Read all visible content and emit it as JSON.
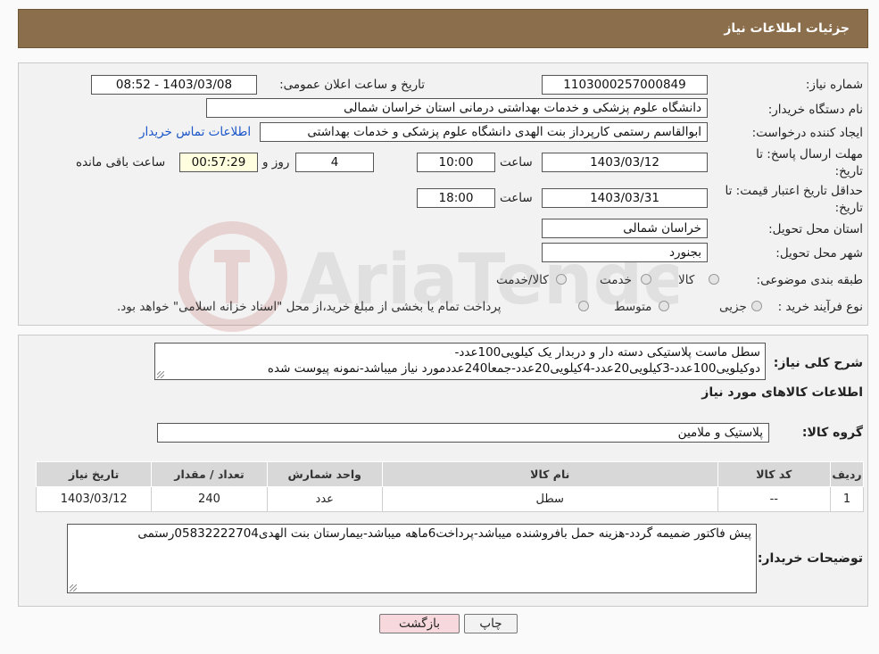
{
  "header": {
    "title": "جزئیات اطلاعات نیاز"
  },
  "form": {
    "need_number_label": "شماره نیاز:",
    "need_number": "1103000257000849",
    "announce_label": "تاریخ و ساعت اعلان عمومی:",
    "announce_value": "1403/03/08 - 08:52",
    "buyer_org_label": "نام دستگاه خریدار:",
    "buyer_org": "دانشگاه علوم پزشکی و خدمات بهداشتی درمانی استان خراسان شمالی",
    "creator_label": "ایجاد کننده درخواست:",
    "creator": "ابوالقاسم رستمی کارپرداز بنت الهدی دانشگاه علوم پزشکی و خدمات بهداشتی",
    "contact_link": "اطلاعات تماس خریدار",
    "deadline_label_1": "مهلت ارسال پاسخ: تا",
    "deadline_label_2": "تاریخ:",
    "deadline_date": "1403/03/12",
    "time_label": "ساعت",
    "deadline_time": "10:00",
    "days_value": "4",
    "days_label": "روز و",
    "remaining_time": "00:57:29",
    "remaining_label": "ساعت باقی مانده",
    "validity_label_1": "حداقل تاریخ اعتبار قیمت: تا",
    "validity_label_2": "تاریخ:",
    "validity_date": "1403/03/31",
    "validity_time": "18:00",
    "province_label": "استان محل تحویل:",
    "province": "خراسان شمالی",
    "city_label": "شهر محل تحویل:",
    "city": "بجنورد",
    "category_label": "طبقه بندی موضوعی:",
    "category_options": [
      "کالا",
      "خدمت",
      "کالا/خدمت"
    ],
    "process_label": "نوع فرآیند خرید :",
    "process_options": [
      "جزیی",
      "متوسط"
    ],
    "payment_note": "پرداخت تمام یا بخشی از مبلغ خرید،از محل \"اسناد خزانه اسلامی\" خواهد بود."
  },
  "details": {
    "summary_label": "شرح کلی نیاز:",
    "summary_line1": "سطل ماست پلاستیکی دسته دار و دربدار یک کیلویی100عدد-",
    "summary_line2": "دوکیلویی100عدد-3کیلویی20عدد-4کیلویی20عدد-جمعا240عددمورد نیاز میباشد-نمونه پیوست شده",
    "goods_info_title": "اطلاعات کالاهای مورد نیاز",
    "group_label": "گروه کالا:",
    "group_value": "پلاستیک و ملامین",
    "table": {
      "headers": [
        "ردیف",
        "کد کالا",
        "نام کالا",
        "واحد شمارش",
        "تعداد / مقدار",
        "تاریخ نیاز"
      ],
      "rows": [
        [
          "1",
          "--",
          "سطل",
          "عدد",
          "240",
          "1403/03/12"
        ]
      ]
    },
    "buyer_notes_label": "توضیحات خریدار:",
    "buyer_notes": "پیش فاکتور ضمیمه گردد-هزینه حمل بافروشنده میباشد-پرداخت6ماهه میباشد-بیمارستان بنت الهدی05832222704رستمی"
  },
  "buttons": {
    "print": "چاپ",
    "back": "بازگشت"
  },
  "colors": {
    "header_bg": "#8b6e4b",
    "link": "#1a55c9",
    "back_button_bg": "#f7d9dd"
  },
  "icons": {
    "watermark": "ariatender-logo"
  }
}
